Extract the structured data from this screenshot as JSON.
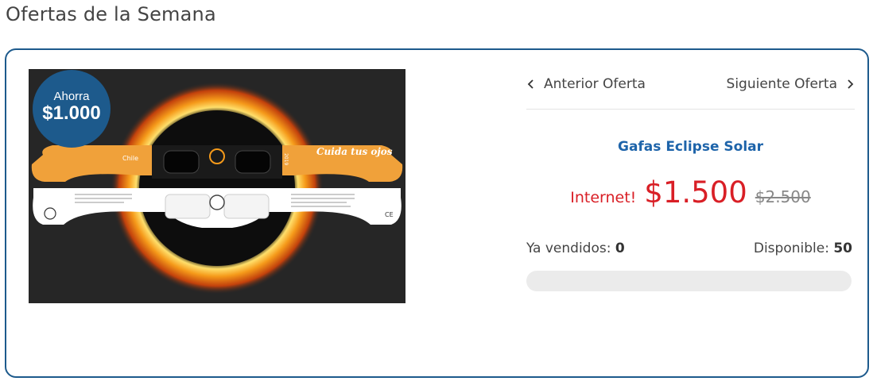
{
  "section": {
    "title": "Ofertas de la Semana"
  },
  "offer": {
    "badge": {
      "label": "Ahorra",
      "amount": "$1.000"
    },
    "image": {
      "alt": "Gafas Eclipse Solar",
      "glasses_text": "Cuida tus ojos",
      "brand_text": "Chile",
      "year_text": "2019",
      "ce_mark": "CE"
    },
    "nav": {
      "prev_label": "Anterior Oferta",
      "next_label": "Siguiente Oferta"
    },
    "product_name": "Gafas Eclipse Solar",
    "price": {
      "label": "Internet!",
      "current": "$1.500",
      "previous": "$2.500"
    },
    "stats": {
      "sold_label": "Ya vendidos:",
      "sold_value": "0",
      "available_label": "Disponible:",
      "available_value": "50"
    },
    "progress": {
      "fraction": 0
    }
  },
  "colors": {
    "brand_blue": "#1d5a8c",
    "link_blue": "#1e64aa",
    "price_red": "#d91f26",
    "glasses_orange": "#f0a13a"
  }
}
